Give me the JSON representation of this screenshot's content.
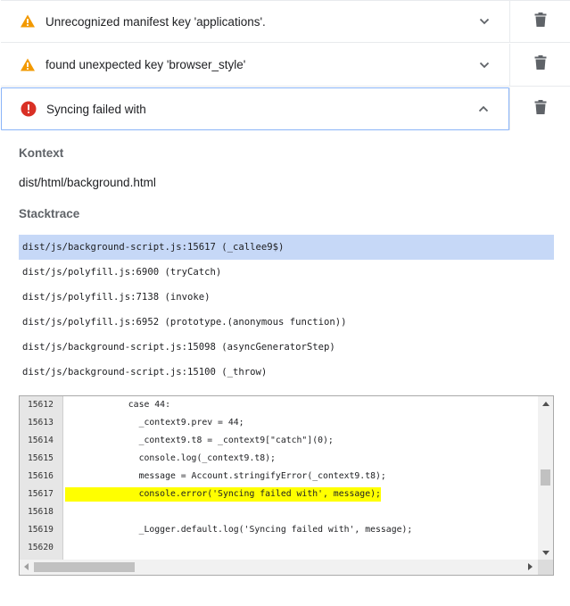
{
  "errors": [
    {
      "severity": "warning",
      "text": "Unrecognized manifest key 'applications'.",
      "expanded": false
    },
    {
      "severity": "warning",
      "text": "found unexpected key 'browser_style'",
      "expanded": false
    },
    {
      "severity": "error",
      "text": "Syncing failed with",
      "expanded": true
    }
  ],
  "details": {
    "context_label": "Kontext",
    "context_value": "dist/html/background.html",
    "stack_label": "Stacktrace",
    "stack": [
      "dist/js/background-script.js:15617 (_callee9$)",
      "dist/js/polyfill.js:6900 (tryCatch)",
      "dist/js/polyfill.js:7138 (invoke)",
      "dist/js/polyfill.js:6952 (prototype.(anonymous function))",
      "dist/js/background-script.js:15098 (asyncGeneratorStep)",
      "dist/js/background-script.js:15100 (_throw)"
    ],
    "selected_stack_index": 0
  },
  "code": {
    "highlight_line": "15617",
    "lines": [
      {
        "num": "15612",
        "text": "            case 44:"
      },
      {
        "num": "15613",
        "text": "              _context9.prev = 44;"
      },
      {
        "num": "15614",
        "text": "              _context9.t8 = _context9[\"catch\"](0);"
      },
      {
        "num": "15615",
        "text": "              console.log(_context9.t8);"
      },
      {
        "num": "15616",
        "text": "              message = Account.stringifyError(_context9.t8);"
      },
      {
        "num": "15617",
        "text": "              console.error('Syncing failed with', message);"
      },
      {
        "num": "15618",
        "text": ""
      },
      {
        "num": "15619",
        "text": "              _Logger.default.log('Syncing failed with', message);"
      },
      {
        "num": "15620",
        "text": ""
      }
    ]
  },
  "colors": {
    "warning": "#f29900",
    "error": "#d93025",
    "selected_stack": "#c6d8f7",
    "highlight": "#ffff00",
    "active_border": "#8ab4f8"
  }
}
